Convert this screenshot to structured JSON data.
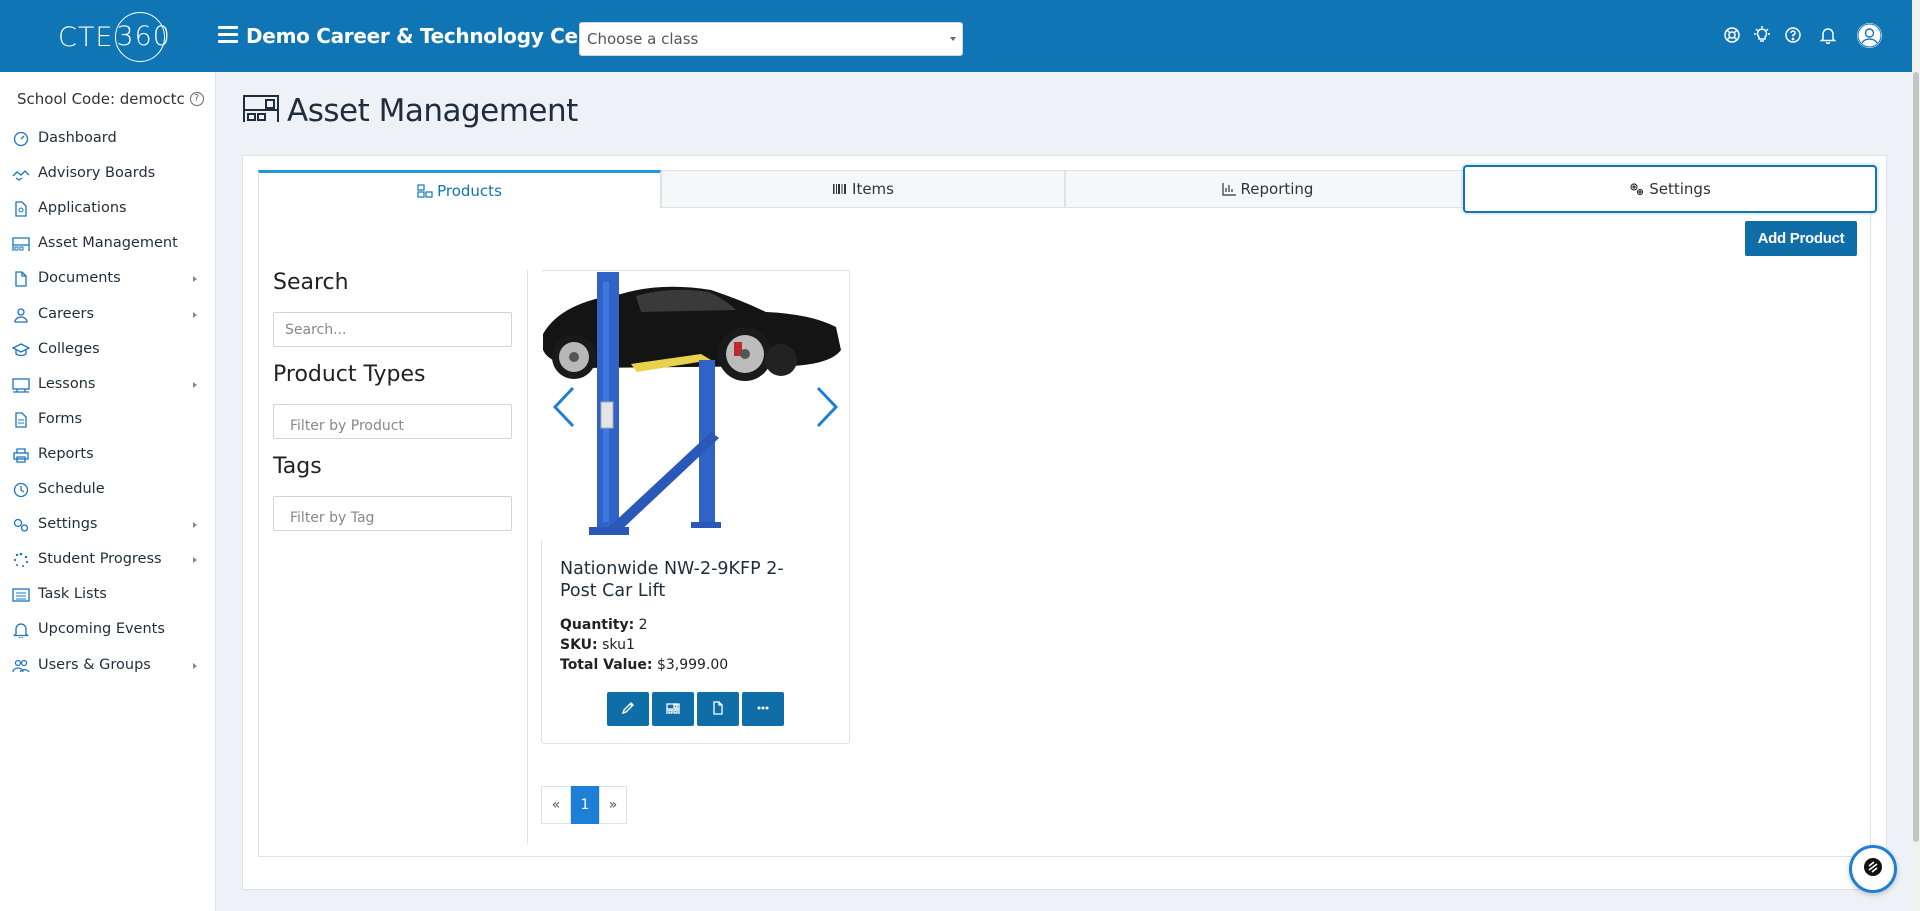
{
  "header": {
    "logo_text": "CTE",
    "logo_circle": "360",
    "org_title": "Demo Career & Technology Center",
    "class_select_placeholder": "Choose a class",
    "icons": [
      "lifebuoy-icon",
      "lightbulb-icon",
      "help-circle-icon",
      "bell-icon",
      "user-avatar-icon"
    ]
  },
  "sidebar": {
    "school_code": "School Code: democtc",
    "items": [
      {
        "label": "Dashboard",
        "icon": "dashboard-icon",
        "has_submenu": false
      },
      {
        "label": "Advisory Boards",
        "icon": "handshake-icon",
        "has_submenu": false
      },
      {
        "label": "Applications",
        "icon": "application-file-icon",
        "has_submenu": false
      },
      {
        "label": "Asset Management",
        "icon": "asset-shelf-icon",
        "has_submenu": false
      },
      {
        "label": "Documents",
        "icon": "document-icon",
        "has_submenu": true
      },
      {
        "label": "Careers",
        "icon": "career-person-icon",
        "has_submenu": true
      },
      {
        "label": "Colleges",
        "icon": "graduation-cap-icon",
        "has_submenu": false
      },
      {
        "label": "Lessons",
        "icon": "lessons-icon",
        "has_submenu": true
      },
      {
        "label": "Forms",
        "icon": "form-icon",
        "has_submenu": false
      },
      {
        "label": "Reports",
        "icon": "printer-icon",
        "has_submenu": false
      },
      {
        "label": "Schedule",
        "icon": "clock-icon",
        "has_submenu": false
      },
      {
        "label": "Settings",
        "icon": "gears-icon",
        "has_submenu": true
      },
      {
        "label": "Student Progress",
        "icon": "spinner-icon",
        "has_submenu": true
      },
      {
        "label": "Task Lists",
        "icon": "list-icon",
        "has_submenu": false
      },
      {
        "label": "Upcoming Events",
        "icon": "bell-icon",
        "has_submenu": false
      },
      {
        "label": "Users & Groups",
        "icon": "users-icon",
        "has_submenu": true
      }
    ]
  },
  "main": {
    "page_title": "Asset Management",
    "tabs": [
      {
        "label": "Products",
        "icon": "products-icon",
        "active": true
      },
      {
        "label": "Items",
        "icon": "barcode-icon",
        "active": false
      },
      {
        "label": "Reporting",
        "icon": "bar-chart-icon",
        "active": false
      },
      {
        "label": "Settings",
        "icon": "gears-icon",
        "active": false,
        "focused": true
      }
    ],
    "add_product_label": "Add Product",
    "filters": {
      "search_heading": "Search",
      "search_placeholder": "Search...",
      "product_types_heading": "Product Types",
      "product_types_placeholder": "Filter by Product",
      "tags_heading": "Tags",
      "tags_placeholder": "Filter by Tag"
    },
    "product": {
      "name": "Nationwide NW-2-9KFP 2-Post Car Lift",
      "quantity_label": "Quantity:",
      "quantity": "2",
      "sku_label": "SKU:",
      "sku": "sku1",
      "total_value_label": "Total Value:",
      "total_value": "$3,999.00",
      "actions": [
        "pencil-icon",
        "inventory-icon",
        "file-icon",
        "more-icon"
      ]
    },
    "pagination": {
      "prev": "«",
      "current": "1",
      "next": "»"
    }
  },
  "colors": {
    "brand_blue": "#0f75b4",
    "button_blue": "#0f6ea8",
    "active_tab_accent": "#1e9be0",
    "sidebar_icon": "#1b74c0"
  }
}
